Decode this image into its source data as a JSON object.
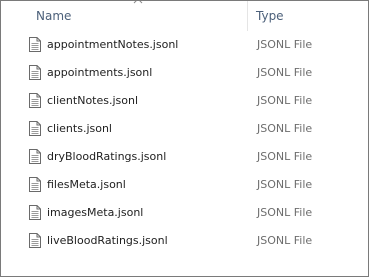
{
  "columns": {
    "name_label": "Name",
    "type_label": "Type"
  },
  "sort_icon": "chevron-up-icon",
  "file_icon": "document-icon",
  "files": [
    {
      "name": "appointmentNotes.jsonl",
      "type": "JSONL File"
    },
    {
      "name": "appointments.jsonl",
      "type": "JSONL File"
    },
    {
      "name": "clientNotes.jsonl",
      "type": "JSONL File"
    },
    {
      "name": "clients.jsonl",
      "type": "JSONL File"
    },
    {
      "name": "dryBloodRatings.jsonl",
      "type": "JSONL File"
    },
    {
      "name": "filesMeta.jsonl",
      "type": "JSONL File"
    },
    {
      "name": "imagesMeta.jsonl",
      "type": "JSONL File"
    },
    {
      "name": "liveBloodRatings.jsonl",
      "type": "JSONL File"
    }
  ]
}
